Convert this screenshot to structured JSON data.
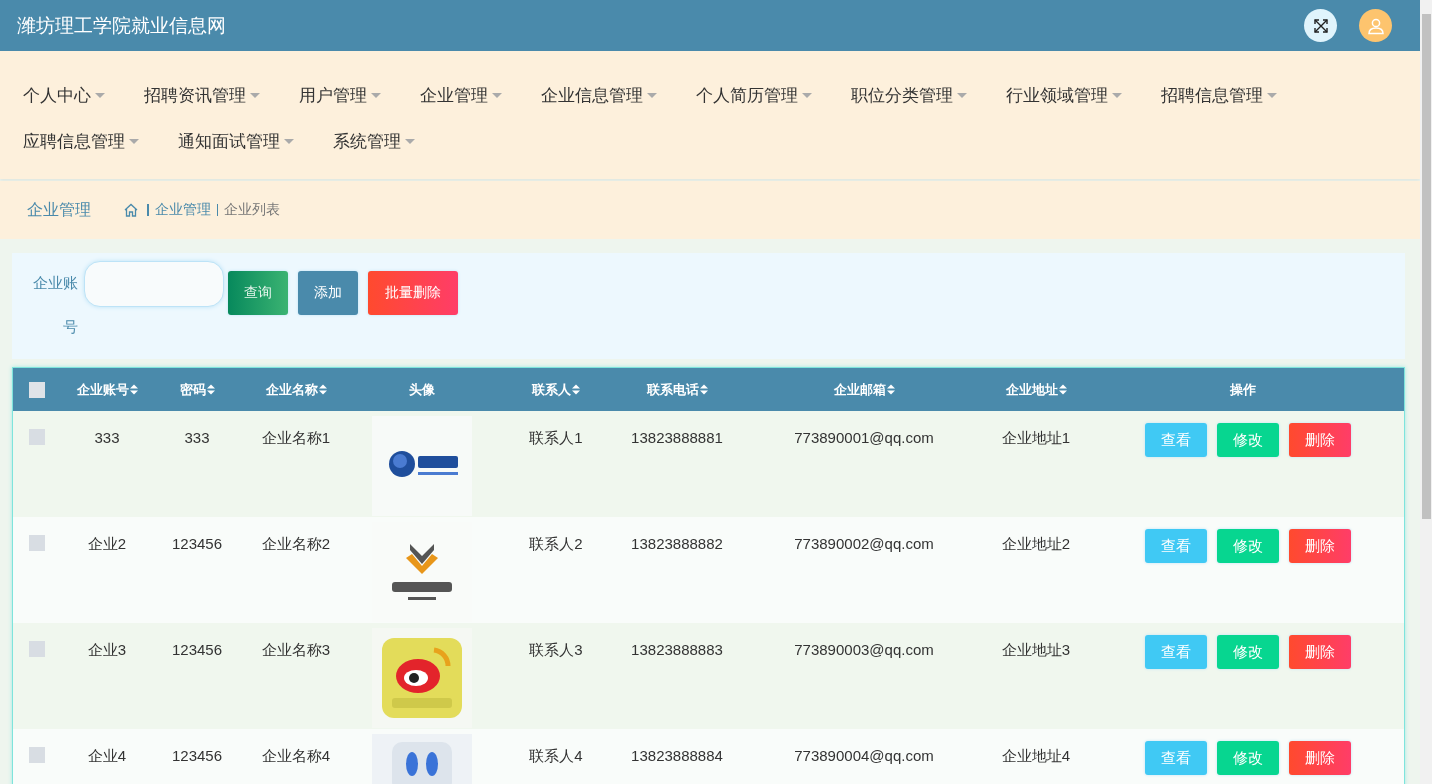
{
  "header": {
    "title": "潍坊理工学院就业信息网"
  },
  "menu": [
    {
      "label": "个人中心"
    },
    {
      "label": "招聘资讯管理"
    },
    {
      "label": "用户管理"
    },
    {
      "label": "企业管理"
    },
    {
      "label": "企业信息管理"
    },
    {
      "label": "个人简历管理"
    },
    {
      "label": "职位分类管理"
    },
    {
      "label": "行业领域管理"
    },
    {
      "label": "招聘信息管理"
    },
    {
      "label": "应聘信息管理"
    },
    {
      "label": "通知面试管理"
    },
    {
      "label": "系统管理"
    }
  ],
  "breadcrumb": {
    "title": "企业管理",
    "path": [
      "企业管理",
      "企业列表"
    ]
  },
  "search": {
    "label": "企业账号",
    "buttons": [
      {
        "label": "查询",
        "kind": "query"
      },
      {
        "label": "添加",
        "kind": "add"
      },
      {
        "label": "批量删除",
        "kind": "delete"
      }
    ]
  },
  "table": {
    "select_all_checked": false,
    "columns": [
      {
        "label": "企业账号",
        "sortable": true
      },
      {
        "label": "密码",
        "sortable": true
      },
      {
        "label": "企业名称",
        "sortable": true
      },
      {
        "label": "头像",
        "sortable": false
      },
      {
        "label": "联系人",
        "sortable": true
      },
      {
        "label": "联系电话",
        "sortable": true
      },
      {
        "label": "企业邮箱",
        "sortable": true
      },
      {
        "label": "企业地址",
        "sortable": true
      },
      {
        "label": "操作",
        "sortable": false
      }
    ],
    "rows": [
      {
        "checked": false,
        "account": "333",
        "password": "333",
        "name": "企业名称1",
        "avatar": {
          "kind": "picture"
        },
        "contact": "联系人1",
        "phone": "13823888881",
        "email": "773890001@qq.com",
        "address": "企业地址1",
        "actions": [
          {
            "label": "查看",
            "kind": "view"
          },
          {
            "label": "修改",
            "kind": "edit"
          },
          {
            "label": "删除",
            "kind": "delete"
          }
        ]
      },
      {
        "checked": false,
        "account": "企业2",
        "password": "123456",
        "name": "企业名称2",
        "avatar": {
          "kind": "picture"
        },
        "contact": "联系人2",
        "phone": "13823888882",
        "email": "773890002@qq.com",
        "address": "企业地址2",
        "actions": [
          {
            "label": "查看",
            "kind": "view"
          },
          {
            "label": "修改",
            "kind": "edit"
          },
          {
            "label": "删除",
            "kind": "delete"
          }
        ]
      },
      {
        "checked": false,
        "account": "企业3",
        "password": "123456",
        "name": "企业名称3",
        "avatar": {
          "kind": "picture"
        },
        "contact": "联系人3",
        "phone": "13823888883",
        "email": "773890003@qq.com",
        "address": "企业地址3",
        "actions": [
          {
            "label": "查看",
            "kind": "view"
          },
          {
            "label": "修改",
            "kind": "edit"
          },
          {
            "label": "删除",
            "kind": "delete"
          }
        ]
      },
      {
        "checked": false,
        "account": "企业4",
        "password": "123456",
        "name": "企业名称4",
        "avatar": {
          "kind": "picture"
        },
        "contact": "联系人4",
        "phone": "13823888884",
        "email": "773890004@qq.com",
        "address": "企业地址4",
        "actions": [
          {
            "label": "查看",
            "kind": "view"
          },
          {
            "label": "修改",
            "kind": "edit"
          },
          {
            "label": "删除",
            "kind": "delete"
          }
        ]
      }
    ]
  }
}
